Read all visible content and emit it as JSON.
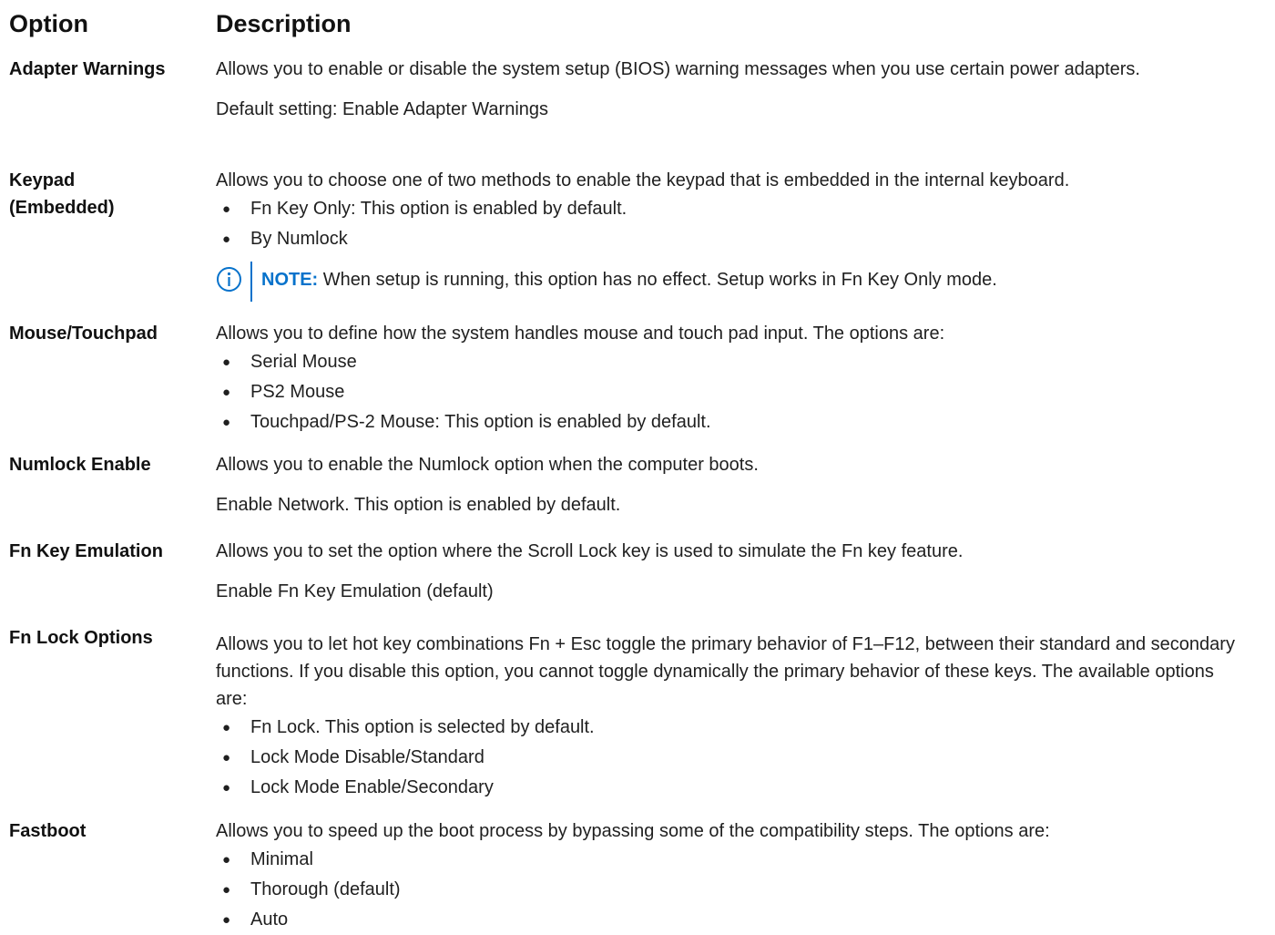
{
  "header": {
    "option": "Option",
    "description": "Description"
  },
  "rows": [
    {
      "option": "Adapter Warnings",
      "desc": "Allows you to enable or disable the system setup (BIOS) warning messages when you use certain power adapters.",
      "extra": "Default setting: Enable Adapter Warnings"
    },
    {
      "option": "Keypad (Embedded)",
      "desc": "Allows you to choose one of two methods to enable the keypad that is embedded in the internal keyboard.",
      "bullets": [
        "Fn Key Only: This option is enabled by default.",
        "By Numlock"
      ],
      "note_label": "NOTE:",
      "note_text": "When setup is running, this option has no effect. Setup works in Fn Key Only mode."
    },
    {
      "option": "Mouse/Touchpad",
      "desc": "Allows you to define how the system handles mouse and touch pad input. The options are:",
      "bullets": [
        "Serial Mouse",
        "PS2 Mouse",
        "Touchpad/PS-2 Mouse: This option is enabled by default."
      ]
    },
    {
      "option": "Numlock Enable",
      "desc": "Allows you to enable the Numlock option when the computer boots.",
      "extra": "Enable Network. This option is enabled by default."
    },
    {
      "option": "Fn Key Emulation",
      "desc": "Allows you to set the option where the Scroll Lock key is used to simulate the Fn key feature.",
      "extra": "Enable Fn Key Emulation (default)"
    },
    {
      "option": "Fn Lock Options",
      "desc": "Allows you to let hot key combinations Fn + Esc toggle the primary behavior of F1–F12, between their standard and secondary functions. If you disable this option, you cannot toggle dynamically the primary behavior of these keys. The available options are:",
      "bullets": [
        "Fn Lock. This option is selected by default.",
        "Lock Mode Disable/Standard",
        "Lock Mode Enable/Secondary"
      ]
    },
    {
      "option": "Fastboot",
      "desc": "Allows you to speed up the boot process by bypassing some of the compatibility steps. The options are:",
      "bullets": [
        "Minimal",
        "Thorough (default)",
        "Auto"
      ]
    }
  ],
  "bullet_glyph": "●",
  "colors": {
    "note_accent": "#0672cb",
    "text": "#1f1f1f"
  }
}
